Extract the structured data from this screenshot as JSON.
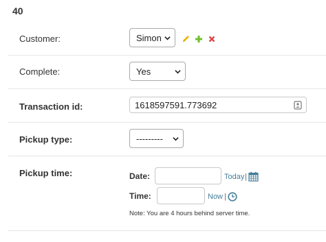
{
  "header": {
    "title": "40"
  },
  "fields": {
    "customer": {
      "label": "Customer:",
      "value": "Simon"
    },
    "complete": {
      "label": "Complete:",
      "value": "Yes"
    },
    "transaction_id": {
      "label": "Transaction id:",
      "value": "1618597591.773692"
    },
    "pickup_type": {
      "label": "Pickup type:",
      "value": "---------"
    },
    "pickup_time": {
      "label": "Pickup time:",
      "date_label": "Date:",
      "date_value": "",
      "today_link": "Today",
      "time_label": "Time:",
      "time_value": "",
      "now_link": "Now",
      "separator": "|",
      "note": "Note: You are 4 hours behind server time."
    }
  },
  "icons": {
    "edit": "pencil-icon",
    "add": "plus-icon",
    "delete": "delete-x-icon",
    "calendar": "calendar-icon",
    "clock": "clock-icon",
    "contact_card": "contact-card-icon"
  },
  "colors": {
    "link": "#447e9b",
    "add": "#70bf2b",
    "delete": "#dd4646",
    "edit": "#efb80b"
  }
}
